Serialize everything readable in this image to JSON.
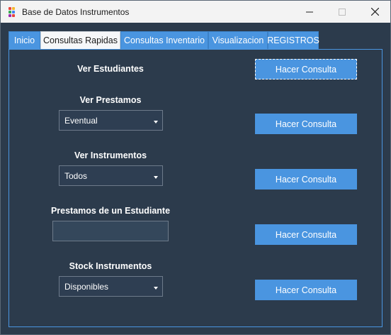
{
  "window": {
    "title": "Base de Datos Instrumentos",
    "icon": "app-dots-icon",
    "controls": [
      "minimize-icon",
      "maximize-icon",
      "close-icon"
    ]
  },
  "tabs": [
    {
      "label": "Inicio",
      "active": false
    },
    {
      "label": "Consultas Rapidas",
      "active": true
    },
    {
      "label": "Consultas Inventario",
      "active": false
    },
    {
      "label": "Visualizacion",
      "active": false
    },
    {
      "label": "REGISTROS",
      "active": false
    }
  ],
  "queries": [
    {
      "label": "Ver Estudiantes",
      "button": "Hacer Consulta"
    },
    {
      "label": "Ver Prestamos",
      "selected": "Eventual",
      "button": "Hacer Consulta"
    },
    {
      "label": "Ver Instrumentos",
      "selected": "Todos",
      "button": "Hacer Consulta"
    },
    {
      "label": "Prestamos de un Estudiante",
      "input_value": "",
      "button": "Hacer Consulta"
    },
    {
      "label": "Stock Instrumentos",
      "selected": "Disponibles",
      "button": "Hacer Consulta"
    }
  ],
  "colors": {
    "background": "#2c3b4c",
    "accent": "#4a95e0",
    "titlebar": "#f3f3f3"
  }
}
